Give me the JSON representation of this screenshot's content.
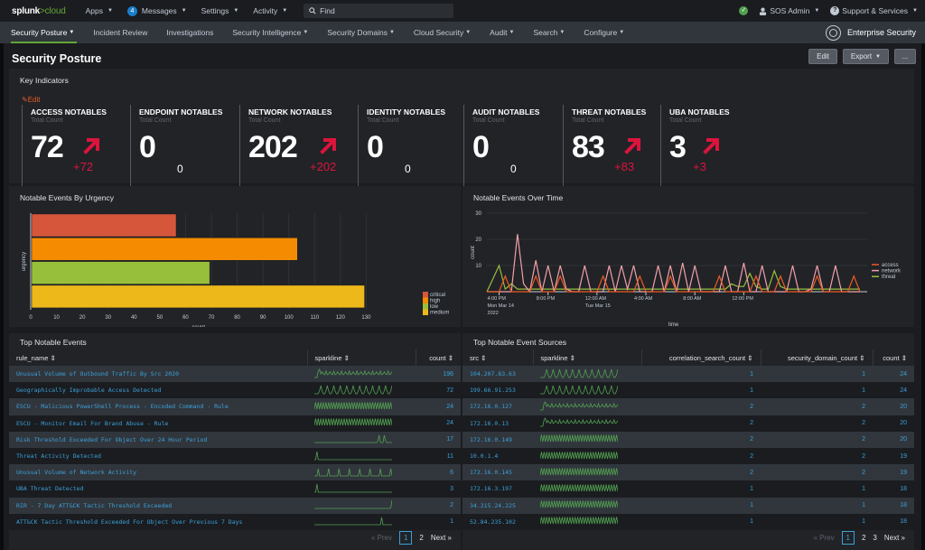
{
  "topbar": {
    "logo_main": "splunk",
    "logo_sub": ">cloud",
    "nav": [
      {
        "label": "Apps"
      },
      {
        "label": "Messages",
        "badge": "4"
      },
      {
        "label": "Settings"
      },
      {
        "label": "Activity"
      }
    ],
    "find_placeholder": "Find",
    "user": "SOS Admin",
    "support": "Support & Services"
  },
  "appbar": {
    "menu": [
      {
        "label": "Security Posture",
        "dropdown": true,
        "active": true
      },
      {
        "label": "Incident Review",
        "dropdown": false
      },
      {
        "label": "Investigations",
        "dropdown": false
      },
      {
        "label": "Security Intelligence",
        "dropdown": true
      },
      {
        "label": "Security Domains",
        "dropdown": true
      },
      {
        "label": "Cloud Security",
        "dropdown": true
      },
      {
        "label": "Audit",
        "dropdown": true
      },
      {
        "label": "Search",
        "dropdown": true
      },
      {
        "label": "Configure",
        "dropdown": true
      }
    ],
    "app_name": "Enterprise Security"
  },
  "page": {
    "title": "Security Posture",
    "buttons": {
      "edit": "Edit",
      "export": "Export",
      "more": "..."
    }
  },
  "key_indicators": {
    "title": "Key Indicators",
    "edit_label": "Edit",
    "sub_label": "Total Count",
    "items": [
      {
        "name": "ACCESS NOTABLES",
        "value": "72",
        "delta": "+72",
        "trend": "up"
      },
      {
        "name": "ENDPOINT NOTABLES",
        "value": "0",
        "delta": "0",
        "trend": "none"
      },
      {
        "name": "NETWORK NOTABLES",
        "value": "202",
        "delta": "+202",
        "trend": "up"
      },
      {
        "name": "IDENTITY NOTABLES",
        "value": "0",
        "delta": "0",
        "trend": "none"
      },
      {
        "name": "AUDIT NOTABLES",
        "value": "0",
        "delta": "0",
        "trend": "none"
      },
      {
        "name": "THREAT NOTABLES",
        "value": "83",
        "delta": "+83",
        "trend": "up"
      },
      {
        "name": "UBA NOTABLES",
        "value": "3",
        "delta": "+3",
        "trend": "up"
      }
    ]
  },
  "chart_data": [
    {
      "type": "bar",
      "orientation": "horizontal",
      "title": "Notable Events By Urgency",
      "xlabel": "count",
      "ylabel": "urgency",
      "categories": [
        "critical",
        "high",
        "low",
        "medium"
      ],
      "values": [
        56,
        103,
        69,
        129
      ],
      "colors": [
        "#d6563c",
        "#f58b00",
        "#98bf3b",
        "#ecb81a"
      ],
      "xlim": [
        0,
        140
      ],
      "xticks": [
        0,
        10,
        20,
        30,
        40,
        50,
        60,
        70,
        80,
        90,
        100,
        110,
        120,
        130
      ],
      "legend": "right",
      "grid": true
    },
    {
      "type": "line",
      "title": "Notable Events Over Time",
      "xlabel": "time",
      "ylabel": "count",
      "ylim": [
        0,
        30
      ],
      "yticks": [
        10,
        20,
        30
      ],
      "xticks": [
        {
          "label": "4:00 PM",
          "sub": [
            "Mon Mar 14",
            "2022"
          ],
          "index": 2
        },
        {
          "label": "8:00 PM",
          "sub": [],
          "index": 10
        },
        {
          "label": "12:00 AM",
          "sub": [
            "Tue Mar 15"
          ],
          "index": 18
        },
        {
          "label": "4:00 AM",
          "sub": [],
          "index": 26
        },
        {
          "label": "8:00 AM",
          "sub": [],
          "index": 34
        },
        {
          "label": "12:00 PM",
          "sub": [],
          "index": 42
        }
      ],
      "legend": "right",
      "series": [
        {
          "name": "access",
          "color": "#ec5a24",
          "values": [
            0,
            0,
            0,
            6,
            0,
            0,
            0,
            0,
            6,
            0,
            0,
            0,
            6,
            0,
            0,
            0,
            0,
            0,
            0,
            6,
            0,
            0,
            0,
            0,
            0,
            6,
            0,
            0,
            0,
            0,
            6,
            0,
            0,
            0,
            0,
            0,
            0,
            0,
            6,
            0,
            0,
            0,
            0,
            0,
            6,
            0,
            0,
            0,
            6,
            0,
            0,
            0,
            0,
            0,
            6,
            0,
            0,
            0,
            0,
            0,
            6,
            0
          ]
        },
        {
          "name": "network",
          "color": "#f2a0a8",
          "values": [
            0,
            0,
            0,
            0,
            0,
            22,
            3,
            0,
            12,
            0,
            10,
            0,
            10,
            1,
            0,
            0,
            10,
            0,
            0,
            0,
            10,
            0,
            10,
            1,
            10,
            0,
            0,
            0,
            10,
            0,
            10,
            0,
            11,
            0,
            10,
            0,
            0,
            0,
            0,
            10,
            0,
            0,
            11,
            0,
            0,
            10,
            0,
            0,
            0,
            0,
            10,
            0,
            0,
            1,
            10,
            0,
            0,
            10,
            0,
            0,
            0,
            0
          ]
        },
        {
          "name": "threat",
          "color": "#98bf3b",
          "values": [
            0,
            5,
            10,
            1,
            3,
            1,
            1,
            1,
            1,
            1,
            1,
            1,
            1,
            1,
            1,
            1,
            1,
            1,
            1,
            1,
            1,
            1,
            1,
            1,
            1,
            1,
            1,
            1,
            1,
            1,
            1,
            1,
            1,
            1,
            1,
            1,
            1,
            1,
            1,
            1,
            3,
            2,
            2,
            7,
            2,
            1,
            1,
            8,
            2,
            1,
            1,
            1,
            1,
            1,
            1,
            1,
            1,
            1,
            1,
            1,
            1,
            1
          ]
        }
      ]
    }
  ],
  "top_notable_events": {
    "title": "Top Notable Events",
    "columns": [
      "rule_name",
      "sparkline",
      "count"
    ],
    "rows": [
      {
        "rule_name": "Unusual Volume of Outbound Traffic By Src 2020",
        "count": "196",
        "spark": "dense"
      },
      {
        "rule_name": "Geographically Improbable Access Detected",
        "count": "72",
        "spark": "periodic"
      },
      {
        "rule_name": "ESCU - Malicious PowerShell Process - Encoded Command - Rule",
        "count": "24",
        "spark": "zigzag"
      },
      {
        "rule_name": "ESCU - Monitor Email For Brand Abuse - Rule",
        "count": "24",
        "spark": "zigzag"
      },
      {
        "rule_name": "Risk Threshold Exceeded For Object Over 24 Hour Period",
        "count": "17",
        "spark": "tail"
      },
      {
        "rule_name": "Threat Activity Detected",
        "count": "11",
        "spark": "head"
      },
      {
        "rule_name": "Unusual Volume of Network Activity",
        "count": "6",
        "spark": "spikes"
      },
      {
        "rule_name": "UBA Threat Detected",
        "count": "3",
        "spark": "head"
      },
      {
        "rule_name": "RIR - 7 Day ATT&CK Tactic Threshold Exceeded",
        "count": "2",
        "spark": "end"
      },
      {
        "rule_name": "ATT&CK Tactic Threshold Exceeded For Object Over Previous 7 Days",
        "count": "1",
        "spark": "late"
      }
    ],
    "pager": {
      "prev": "« Prev",
      "pages": [
        "1",
        "2"
      ],
      "current": "1",
      "next": "Next »"
    }
  },
  "top_notable_sources": {
    "title": "Top Notable Event Sources",
    "columns": [
      "src",
      "sparkline",
      "correlation_search_count",
      "security_domain_count",
      "count"
    ],
    "rows": [
      {
        "src": "104.207.83.63",
        "correlation_search_count": "1",
        "security_domain_count": "1",
        "count": "24",
        "spark": "periodic"
      },
      {
        "src": "199.66.91.253",
        "correlation_search_count": "1",
        "security_domain_count": "1",
        "count": "24",
        "spark": "periodic"
      },
      {
        "src": "172.16.0.127",
        "correlation_search_count": "2",
        "security_domain_count": "2",
        "count": "20",
        "spark": "dense"
      },
      {
        "src": "172.16.0.13",
        "correlation_search_count": "2",
        "security_domain_count": "2",
        "count": "20",
        "spark": "dense"
      },
      {
        "src": "172.16.0.149",
        "correlation_search_count": "2",
        "security_domain_count": "2",
        "count": "20",
        "spark": "zigzag"
      },
      {
        "src": "10.0.1.4",
        "correlation_search_count": "2",
        "security_domain_count": "2",
        "count": "19",
        "spark": "zigzag"
      },
      {
        "src": "172.16.0.145",
        "correlation_search_count": "2",
        "security_domain_count": "2",
        "count": "19",
        "spark": "zigzag"
      },
      {
        "src": "172.16.3.197",
        "correlation_search_count": "1",
        "security_domain_count": "1",
        "count": "18",
        "spark": "zigzag"
      },
      {
        "src": "34.215.24.225",
        "correlation_search_count": "1",
        "security_domain_count": "1",
        "count": "18",
        "spark": "zigzag"
      },
      {
        "src": "52.84.235.102",
        "correlation_search_count": "1",
        "security_domain_count": "1",
        "count": "18",
        "spark": "zigzag"
      }
    ],
    "pager": {
      "prev": "« Prev",
      "pages": [
        "1",
        "2",
        "3"
      ],
      "current": "1",
      "next": "Next »"
    }
  },
  "colors": {
    "accent_green": "#65a637",
    "link_blue": "#3ca0d6",
    "alert_red": "#dc143c",
    "edit_orange": "#ec5a24"
  }
}
